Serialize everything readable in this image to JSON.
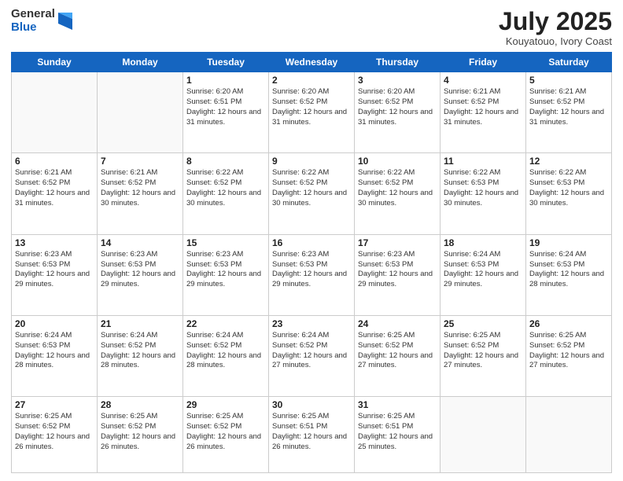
{
  "header": {
    "logo_general": "General",
    "logo_blue": "Blue",
    "title": "July 2025",
    "location": "Kouyatouo, Ivory Coast"
  },
  "days_of_week": [
    "Sunday",
    "Monday",
    "Tuesday",
    "Wednesday",
    "Thursday",
    "Friday",
    "Saturday"
  ],
  "weeks": [
    [
      {
        "day": "",
        "info": ""
      },
      {
        "day": "",
        "info": ""
      },
      {
        "day": "1",
        "info": "Sunrise: 6:20 AM\nSunset: 6:51 PM\nDaylight: 12 hours and 31 minutes."
      },
      {
        "day": "2",
        "info": "Sunrise: 6:20 AM\nSunset: 6:52 PM\nDaylight: 12 hours and 31 minutes."
      },
      {
        "day": "3",
        "info": "Sunrise: 6:20 AM\nSunset: 6:52 PM\nDaylight: 12 hours and 31 minutes."
      },
      {
        "day": "4",
        "info": "Sunrise: 6:21 AM\nSunset: 6:52 PM\nDaylight: 12 hours and 31 minutes."
      },
      {
        "day": "5",
        "info": "Sunrise: 6:21 AM\nSunset: 6:52 PM\nDaylight: 12 hours and 31 minutes."
      }
    ],
    [
      {
        "day": "6",
        "info": "Sunrise: 6:21 AM\nSunset: 6:52 PM\nDaylight: 12 hours and 31 minutes."
      },
      {
        "day": "7",
        "info": "Sunrise: 6:21 AM\nSunset: 6:52 PM\nDaylight: 12 hours and 30 minutes."
      },
      {
        "day": "8",
        "info": "Sunrise: 6:22 AM\nSunset: 6:52 PM\nDaylight: 12 hours and 30 minutes."
      },
      {
        "day": "9",
        "info": "Sunrise: 6:22 AM\nSunset: 6:52 PM\nDaylight: 12 hours and 30 minutes."
      },
      {
        "day": "10",
        "info": "Sunrise: 6:22 AM\nSunset: 6:52 PM\nDaylight: 12 hours and 30 minutes."
      },
      {
        "day": "11",
        "info": "Sunrise: 6:22 AM\nSunset: 6:53 PM\nDaylight: 12 hours and 30 minutes."
      },
      {
        "day": "12",
        "info": "Sunrise: 6:22 AM\nSunset: 6:53 PM\nDaylight: 12 hours and 30 minutes."
      }
    ],
    [
      {
        "day": "13",
        "info": "Sunrise: 6:23 AM\nSunset: 6:53 PM\nDaylight: 12 hours and 29 minutes."
      },
      {
        "day": "14",
        "info": "Sunrise: 6:23 AM\nSunset: 6:53 PM\nDaylight: 12 hours and 29 minutes."
      },
      {
        "day": "15",
        "info": "Sunrise: 6:23 AM\nSunset: 6:53 PM\nDaylight: 12 hours and 29 minutes."
      },
      {
        "day": "16",
        "info": "Sunrise: 6:23 AM\nSunset: 6:53 PM\nDaylight: 12 hours and 29 minutes."
      },
      {
        "day": "17",
        "info": "Sunrise: 6:23 AM\nSunset: 6:53 PM\nDaylight: 12 hours and 29 minutes."
      },
      {
        "day": "18",
        "info": "Sunrise: 6:24 AM\nSunset: 6:53 PM\nDaylight: 12 hours and 29 minutes."
      },
      {
        "day": "19",
        "info": "Sunrise: 6:24 AM\nSunset: 6:53 PM\nDaylight: 12 hours and 28 minutes."
      }
    ],
    [
      {
        "day": "20",
        "info": "Sunrise: 6:24 AM\nSunset: 6:53 PM\nDaylight: 12 hours and 28 minutes."
      },
      {
        "day": "21",
        "info": "Sunrise: 6:24 AM\nSunset: 6:52 PM\nDaylight: 12 hours and 28 minutes."
      },
      {
        "day": "22",
        "info": "Sunrise: 6:24 AM\nSunset: 6:52 PM\nDaylight: 12 hours and 28 minutes."
      },
      {
        "day": "23",
        "info": "Sunrise: 6:24 AM\nSunset: 6:52 PM\nDaylight: 12 hours and 27 minutes."
      },
      {
        "day": "24",
        "info": "Sunrise: 6:25 AM\nSunset: 6:52 PM\nDaylight: 12 hours and 27 minutes."
      },
      {
        "day": "25",
        "info": "Sunrise: 6:25 AM\nSunset: 6:52 PM\nDaylight: 12 hours and 27 minutes."
      },
      {
        "day": "26",
        "info": "Sunrise: 6:25 AM\nSunset: 6:52 PM\nDaylight: 12 hours and 27 minutes."
      }
    ],
    [
      {
        "day": "27",
        "info": "Sunrise: 6:25 AM\nSunset: 6:52 PM\nDaylight: 12 hours and 26 minutes."
      },
      {
        "day": "28",
        "info": "Sunrise: 6:25 AM\nSunset: 6:52 PM\nDaylight: 12 hours and 26 minutes."
      },
      {
        "day": "29",
        "info": "Sunrise: 6:25 AM\nSunset: 6:52 PM\nDaylight: 12 hours and 26 minutes."
      },
      {
        "day": "30",
        "info": "Sunrise: 6:25 AM\nSunset: 6:51 PM\nDaylight: 12 hours and 26 minutes."
      },
      {
        "day": "31",
        "info": "Sunrise: 6:25 AM\nSunset: 6:51 PM\nDaylight: 12 hours and 25 minutes."
      },
      {
        "day": "",
        "info": ""
      },
      {
        "day": "",
        "info": ""
      }
    ]
  ]
}
